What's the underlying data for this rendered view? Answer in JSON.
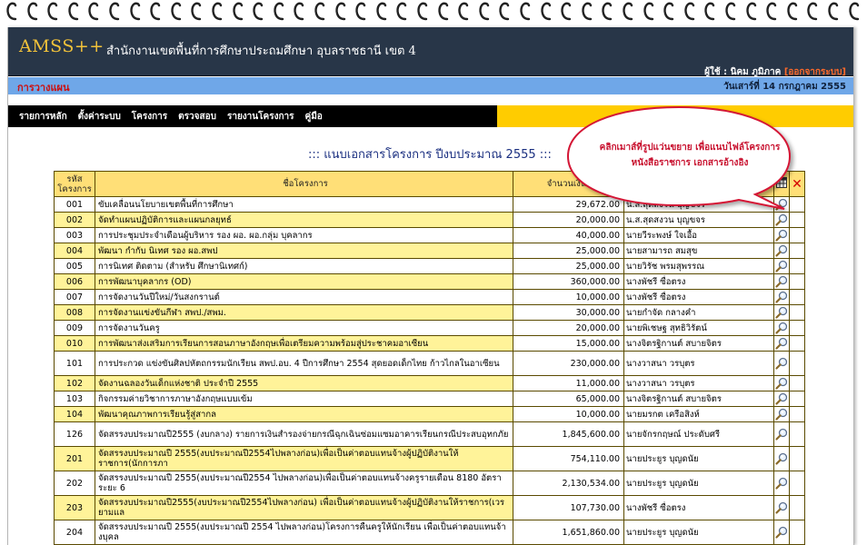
{
  "app": {
    "logo": "AMSS++",
    "agency": "สำนักงานเขตพื้นที่การศึกษาประถมศึกษา อุบลราชธานี เขต 4",
    "user_prefix": "ผู้ใช้ : นิคม ภูมิภาค",
    "logout_label": "[ออกจากระบบ]",
    "section_label": "การวางแผน",
    "date_text": "วันเสาร์ที่ 14 กรกฎาคม 2555"
  },
  "menu": [
    "รายการหลัก",
    "ตั้งค่าระบบ",
    "โครงการ",
    "ตรวจสอบ",
    "รายงานโครงการ",
    "คู่มือ"
  ],
  "page_title": "::: แนบเอกสารโครงการ ปีงบประมาณ 2555 :::",
  "callout": {
    "line1": "คลิกเมาส์ที่รูปแว่นขยาย เพื่อแนบไฟล์โครงการ",
    "line2": "หนังสือราชการ  เอกสารอ้างอิง"
  },
  "table": {
    "headers": {
      "id": "รหัส\nโครงการ",
      "name": "ชื่อโครงการ",
      "amount": "จำนวนเงิน",
      "resp": ""
    },
    "icons": {
      "attach_header": "table-icon",
      "delete_header": "close-icon",
      "row_action": "magnifier-icon"
    },
    "rows": [
      {
        "id": "001",
        "name": "ขับเคลื่อนนโยบายเขตพื้นที่การศึกษา",
        "amount": "29,672.00",
        "resp": "น.ส.สุดสงวน บุญขจร"
      },
      {
        "id": "002",
        "name": "จัดทำแผนปฏิบัติการและแผนกลยุทธ์",
        "amount": "20,000.00",
        "resp": "น.ส.สุดสงวน บุญขจร"
      },
      {
        "id": "003",
        "name": "การประชุมประจำเดือนผู้บริหาร รอง ผอ. ผอ.กลุ่ม บุคลากร",
        "amount": "40,000.00",
        "resp": "นายวีระพงษ์ ใจเอื้อ"
      },
      {
        "id": "004",
        "name": "พัฒนา กำกับ นิเทศ รอง ผอ.สพป",
        "amount": "25,000.00",
        "resp": "นายสามารถ สมสุข"
      },
      {
        "id": "005",
        "name": "การนิเทศ ติดตาม (สำหรับ ศึกษานิเทศก์)",
        "amount": "25,000.00",
        "resp": "นายวิรัช พรมสุพรรณ"
      },
      {
        "id": "006",
        "name": "การพัฒนาบุคลากร (OD)",
        "amount": "360,000.00",
        "resp": "นางพัชรี ซื่อตรง"
      },
      {
        "id": "007",
        "name": "การจัดงานวันปีใหม่/วันสงกรานต์",
        "amount": "10,000.00",
        "resp": "นางพัชรี ซื่อตรง"
      },
      {
        "id": "008",
        "name": "การจัดงานแข่งขันกีฬา สพป./สพม.",
        "amount": "30,000.00",
        "resp": "นายกำจัด กลางคำ"
      },
      {
        "id": "009",
        "name": "การจัดงานวันครู",
        "amount": "20,000.00",
        "resp": "นายพิเชษฐ สุทธิวิรัตน์"
      },
      {
        "id": "010",
        "name": "การพัฒนาส่งเสริมการเรียนการสอนภาษาอังกฤษเพื่อเตรียมความพร้อมสู่ประชาคมอาเซียน",
        "amount": "15,000.00",
        "resp": "นางจิตรฐิกานต์ สบายจิตร"
      },
      {
        "id": "101",
        "name": "การประกวด แข่งขันศิลปหัตถกรรมนักเรียน สพป.อบ. 4 ปีการศึกษา 2554 สุดยอดเด็กไทย ก้าวไกลในอาเซียน",
        "amount": "230,000.00",
        "resp": "นางวาสนา วรบุตร"
      },
      {
        "id": "102",
        "name": "จัดงานฉลองวันเด็กแห่งชาติ ประจำปี 2555",
        "amount": "11,000.00",
        "resp": "นางวาสนา วรบุตร"
      },
      {
        "id": "103",
        "name": "กิจกรรมค่ายวิชาการภาษาอังกฤษแบบเข้ม",
        "amount": "65,000.00",
        "resp": "นางจิตรฐิกานต์ สบายจิตร"
      },
      {
        "id": "104",
        "name": "พัฒนาคุณภาพการเรียนรู้สู่สากล",
        "amount": "10,000.00",
        "resp": "นายมรกต เครือสิงห์"
      },
      {
        "id": "126",
        "name": "จัดสรรงบประมาณปี2555 (งบกลาง) รายการเงินสำรองจ่ายกรณีฉุกเฉินซ่อมแซมอาคารเรียนกรณีประสบอุทกภัย",
        "amount": "1,845,600.00",
        "resp": "นายจักรกฤษณ์ ประดับศรี"
      },
      {
        "id": "201",
        "name": "จัดสรรงบประมาณปี 2555(งบประมาณปี2554ไปพลางก่อน)เพื่อเป็นค่าตอบแทนจ้างผู้ปฏิบัติงานให้ราชการ(นักการภา",
        "amount": "754,110.00",
        "resp": "นายประยูร บุญดนัย"
      },
      {
        "id": "202",
        "name": "จัดสรรงบประมาณปี 2555(งบประมาณปี2554 ไปพลางก่อน)เพื่อเป็นค่าตอบแทนจ้างครูรายเดือน 8180 อัตรา ระยะ 6",
        "amount": "2,130,534.00",
        "resp": "นายประยูร บุญดนัย"
      },
      {
        "id": "203",
        "name": "จัดสรรงบประมาณปี2555(งบประมาณปี2554ไปพลางก่อน) เพื่อเป็นค่าตอบแทนจ้างผู้ปฏิบัติงานให้ราชการ(เวรยามแล",
        "amount": "107,730.00",
        "resp": "นางพัชรี ซื่อตรง"
      },
      {
        "id": "204",
        "name": "จัดสรรงบประมาณปี 2555(งบประมาณปี 2554 ไปพลางก่อน)โครงการคืนครูให้นักเรียน เพื่อเป็นค่าตอบแทนจ้างบุคล",
        "amount": "1,651,860.00",
        "resp": "นายประยูร บุญดนัย"
      }
    ]
  }
}
